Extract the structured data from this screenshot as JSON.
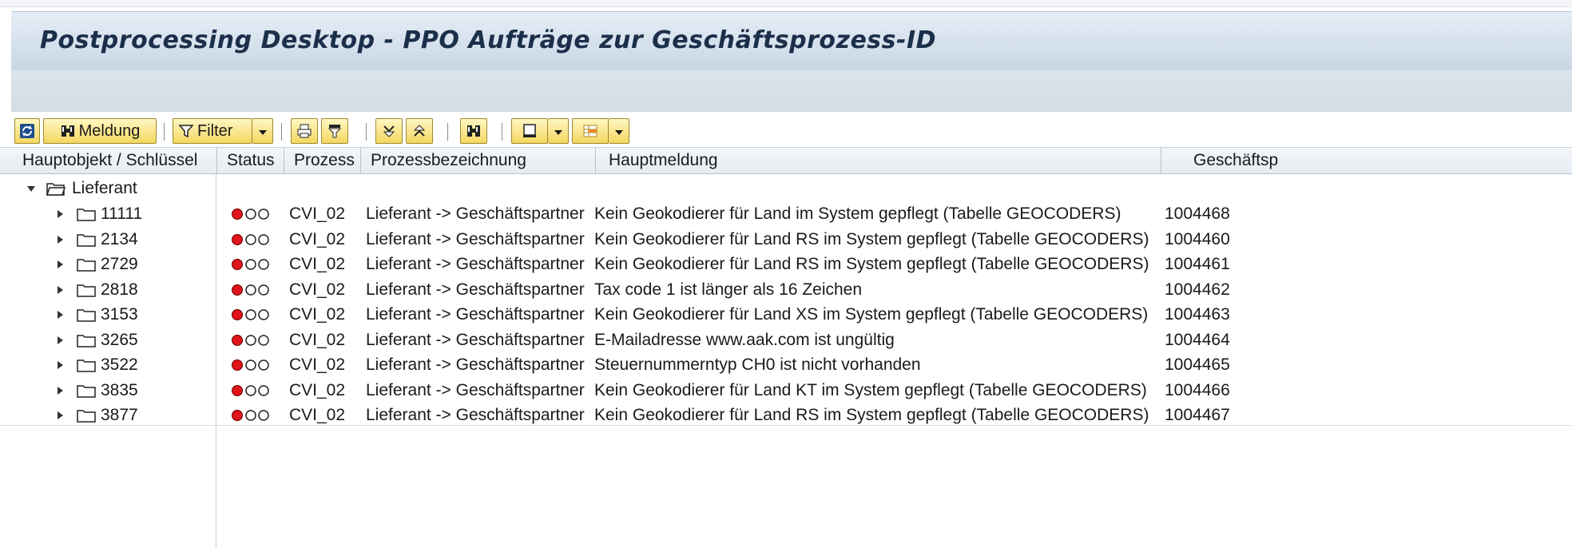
{
  "window": {
    "title": "Postprocessing Desktop  - PPO Aufträge zur Geschäftsprozess-ID"
  },
  "toolbar": {
    "refresh_icon": "refresh-icon",
    "message_label": "Meldung",
    "filter_label": "Filter"
  },
  "table": {
    "columns": [
      "Hauptobjekt / Schlüssel",
      "Status",
      "Prozess",
      "Prozessbezeichnung",
      "Hauptmeldung",
      "Geschäftsp"
    ],
    "group": "Lieferant",
    "rows": [
      {
        "key": "11111",
        "process": "CVI_02",
        "description": "Lieferant -> Geschäftspartner",
        "message": "Kein Geokodierer für Land  im System gepflegt (Tabelle GEOCODERS)",
        "bp_id": "1004468"
      },
      {
        "key": "2134",
        "process": "CVI_02",
        "description": "Lieferant -> Geschäftspartner",
        "message": "Kein Geokodierer für Land RS im System gepflegt (Tabelle GEOCODERS)",
        "bp_id": "1004460"
      },
      {
        "key": "2729",
        "process": "CVI_02",
        "description": "Lieferant -> Geschäftspartner",
        "message": "Kein Geokodierer für Land RS im System gepflegt (Tabelle GEOCODERS)",
        "bp_id": "1004461"
      },
      {
        "key": "2818",
        "process": "CVI_02",
        "description": "Lieferant -> Geschäftspartner",
        "message": "Tax code 1  ist länger als 16 Zeichen",
        "bp_id": "1004462"
      },
      {
        "key": "3153",
        "process": "CVI_02",
        "description": "Lieferant -> Geschäftspartner",
        "message": "Kein Geokodierer für Land XS im System gepflegt (Tabelle GEOCODERS)",
        "bp_id": "1004463"
      },
      {
        "key": "3265",
        "process": "CVI_02",
        "description": "Lieferant -> Geschäftspartner",
        "message": "E-Mailadresse www.aak.com ist ungültig",
        "bp_id": "1004464"
      },
      {
        "key": "3522",
        "process": "CVI_02",
        "description": "Lieferant -> Geschäftspartner",
        "message": "Steuernummerntyp CH0 ist nicht vorhanden",
        "bp_id": "1004465"
      },
      {
        "key": "3835",
        "process": "CVI_02",
        "description": "Lieferant -> Geschäftspartner",
        "message": "Kein Geokodierer für Land KT im System gepflegt (Tabelle GEOCODERS)",
        "bp_id": "1004466"
      },
      {
        "key": "3877",
        "process": "CVI_02",
        "description": "Lieferant -> Geschäftspartner",
        "message": "Kein Geokodierer für Land RS im System gepflegt (Tabelle GEOCODERS)",
        "bp_id": "1004467"
      }
    ]
  },
  "colors": {
    "status_red": "#e0141a",
    "toolbar_button": "#f4d760",
    "title_text": "#1c2f4a"
  }
}
